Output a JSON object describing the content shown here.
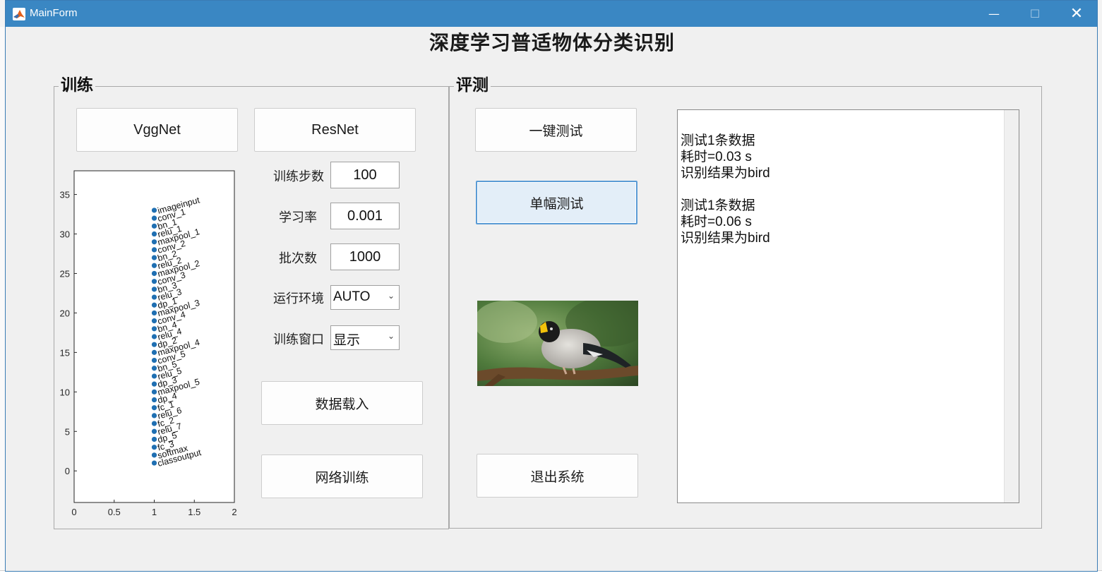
{
  "window": {
    "title": "MainForm",
    "minimize": "—",
    "maximize": "☐",
    "close": "✕"
  },
  "heading": "深度学习普适物体分类识别",
  "train": {
    "title": "训练",
    "vgg_label": "VggNet",
    "resnet_label": "ResNet",
    "steps": {
      "label": "训练步数",
      "value": "100"
    },
    "lr": {
      "label": "学习率",
      "value": "0.001"
    },
    "batch": {
      "label": "批次数",
      "value": "1000"
    },
    "env": {
      "label": "运行环境",
      "selected": "AUTO"
    },
    "window_opt": {
      "label": "训练窗口",
      "selected": "显示"
    },
    "load_label": "数据载入",
    "train_label": "网络训练"
  },
  "eval": {
    "title": "评测",
    "one_click_label": "一键测试",
    "single_label": "单幅测试",
    "exit_label": "退出系统",
    "output_lines": [
      "测试1条数据",
      "耗时=0.03 s",
      "识别结果为bird",
      "",
      "测试1条数据",
      "耗时=0.06 s",
      "识别结果为bird"
    ]
  },
  "chart_data": {
    "type": "scatter",
    "title": "",
    "xlabel": "",
    "ylabel": "",
    "xlim": [
      0,
      2
    ],
    "ylim": [
      -4,
      38
    ],
    "xticks": [
      "0",
      "0.5",
      "1",
      "1.5",
      "2"
    ],
    "yticks": [
      "0",
      "5",
      "10",
      "15",
      "20",
      "25",
      "30",
      "35"
    ],
    "point_color": "#1f6fb2",
    "points": [
      {
        "x": 1,
        "y": 33,
        "label": "imageinput"
      },
      {
        "x": 1,
        "y": 32,
        "label": "conv_1"
      },
      {
        "x": 1,
        "y": 31,
        "label": "bn_1"
      },
      {
        "x": 1,
        "y": 30,
        "label": "relu_1"
      },
      {
        "x": 1,
        "y": 29,
        "label": "maxpool_1"
      },
      {
        "x": 1,
        "y": 28,
        "label": "conv_2"
      },
      {
        "x": 1,
        "y": 27,
        "label": "bn_2"
      },
      {
        "x": 1,
        "y": 26,
        "label": "relu_2"
      },
      {
        "x": 1,
        "y": 25,
        "label": "maxpool_2"
      },
      {
        "x": 1,
        "y": 24,
        "label": "conv_3"
      },
      {
        "x": 1,
        "y": 23,
        "label": "bn_3"
      },
      {
        "x": 1,
        "y": 22,
        "label": "relu_3"
      },
      {
        "x": 1,
        "y": 21,
        "label": "dp_1"
      },
      {
        "x": 1,
        "y": 20,
        "label": "maxpool_3"
      },
      {
        "x": 1,
        "y": 19,
        "label": "conv_4"
      },
      {
        "x": 1,
        "y": 18,
        "label": "bn_4"
      },
      {
        "x": 1,
        "y": 17,
        "label": "relu_4"
      },
      {
        "x": 1,
        "y": 16,
        "label": "dp_2"
      },
      {
        "x": 1,
        "y": 15,
        "label": "maxpool_4"
      },
      {
        "x": 1,
        "y": 14,
        "label": "conv_5"
      },
      {
        "x": 1,
        "y": 13,
        "label": "bn_5"
      },
      {
        "x": 1,
        "y": 12,
        "label": "relu_5"
      },
      {
        "x": 1,
        "y": 11,
        "label": "dp_3"
      },
      {
        "x": 1,
        "y": 10,
        "label": "maxpool_5"
      },
      {
        "x": 1,
        "y": 9,
        "label": "dp_4"
      },
      {
        "x": 1,
        "y": 8,
        "label": "fc_1"
      },
      {
        "x": 1,
        "y": 7,
        "label": "relu_6"
      },
      {
        "x": 1,
        "y": 6,
        "label": "fc_2"
      },
      {
        "x": 1,
        "y": 5,
        "label": "relu_7"
      },
      {
        "x": 1,
        "y": 4,
        "label": "dp_5"
      },
      {
        "x": 1,
        "y": 3,
        "label": "fc_3"
      },
      {
        "x": 1,
        "y": 2,
        "label": "softmax"
      },
      {
        "x": 1,
        "y": 1,
        "label": "classoutput"
      }
    ]
  }
}
